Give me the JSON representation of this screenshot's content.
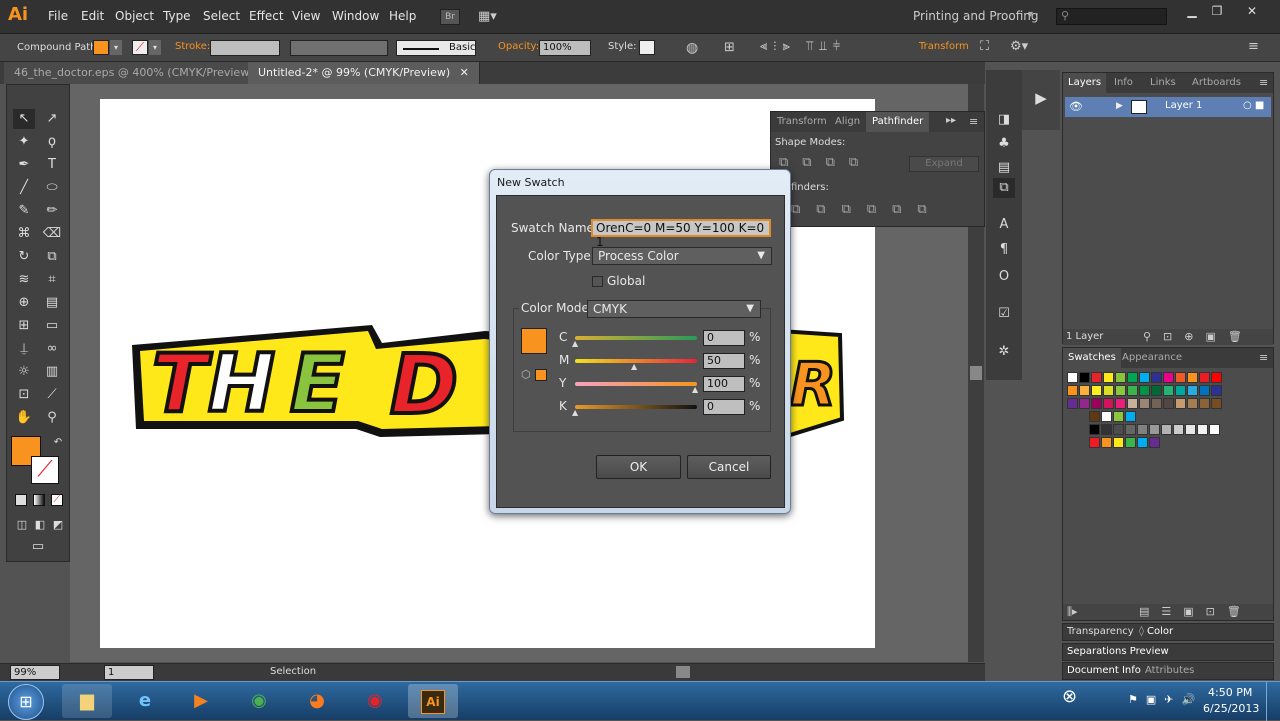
{
  "app": {
    "logo": "Ai",
    "workspace": "Printing and Proofing"
  },
  "menu": [
    "File",
    "Edit",
    "Object",
    "Type",
    "Select",
    "Effect",
    "View",
    "Window",
    "Help"
  ],
  "control_bar": {
    "object_label": "Compound Path",
    "stroke_label": "Stroke:",
    "brush_label": "Basic",
    "opacity_label": "Opacity:",
    "opacity_value": "100%",
    "style_label": "Style:",
    "transform_label": "Transform"
  },
  "doc_tabs": [
    {
      "label": "46_the_doctor.eps @ 400% (CMYK/Preview)"
    },
    {
      "label": "Untitled-2* @ 99% (CMYK/Preview)"
    }
  ],
  "pathfinder": {
    "tabs": [
      "Transform",
      "Align",
      "Pathfinder"
    ],
    "shape_modes_label": "Shape Modes:",
    "pathfinders_label": "finders:",
    "expand_label": "Expand"
  },
  "artwork_text": [
    "THE",
    "DOC",
    "R"
  ],
  "dialog": {
    "title": "New Swatch",
    "swatch_name_label": "Swatch Name:",
    "swatch_name_value": "OrenC=0 M=50 Y=100 K=0 1",
    "color_type_label": "Color Type:",
    "color_type_value": "Process Color",
    "global_label": "Global",
    "color_mode_label": "Color Mode:",
    "color_mode_value": "CMYK",
    "channels": [
      {
        "name": "C",
        "value": "0",
        "unit": "%"
      },
      {
        "name": "M",
        "value": "50",
        "unit": "%"
      },
      {
        "name": "Y",
        "value": "100",
        "unit": "%"
      },
      {
        "name": "K",
        "value": "0",
        "unit": "%"
      }
    ],
    "ok_label": "OK",
    "cancel_label": "Cancel",
    "preview_color": "#f7931e"
  },
  "layers_panel": {
    "tabs": [
      "Layers",
      "Info",
      "Links",
      "Artboards"
    ],
    "layer_name": "Layer 1",
    "footer": "1 Layer"
  },
  "swatches_panel": {
    "tabs": [
      "Swatches",
      "Appearance"
    ]
  },
  "mini_panels": {
    "transparency": "Transparency",
    "color": "Color",
    "separations": "Separations Preview",
    "docinfo": "Document Info",
    "attributes": "Attributes"
  },
  "status": {
    "zoom": "99%",
    "artboard": "1",
    "tool": "Selection"
  },
  "taskbar": {
    "time": "4:50 PM",
    "date": "6/25/2013"
  },
  "colors": {
    "accent": "#f7931e",
    "taskbar": "#2f6aa0"
  }
}
